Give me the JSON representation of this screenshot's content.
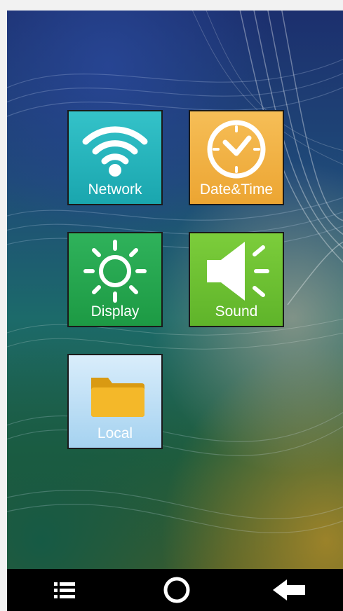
{
  "tiles": [
    {
      "id": "network",
      "label": "Network",
      "icon": "wifi-icon",
      "color": "#20b0b8"
    },
    {
      "id": "datetime",
      "label": "Date&Time",
      "icon": "clock-icon",
      "color": "#f0ab3a"
    },
    {
      "id": "display",
      "label": "Display",
      "icon": "sun-icon",
      "color": "#24a24d"
    },
    {
      "id": "sound",
      "label": "Sound",
      "icon": "speaker-icon",
      "color": "#6cc033"
    },
    {
      "id": "local",
      "label": "Local",
      "icon": "folder-icon",
      "color": "#b9dcf3"
    }
  ],
  "navbar": {
    "menu_icon": "menu-list-icon",
    "home_icon": "home-circle-icon",
    "back_icon": "back-arrow-icon",
    "background": "#000000"
  }
}
